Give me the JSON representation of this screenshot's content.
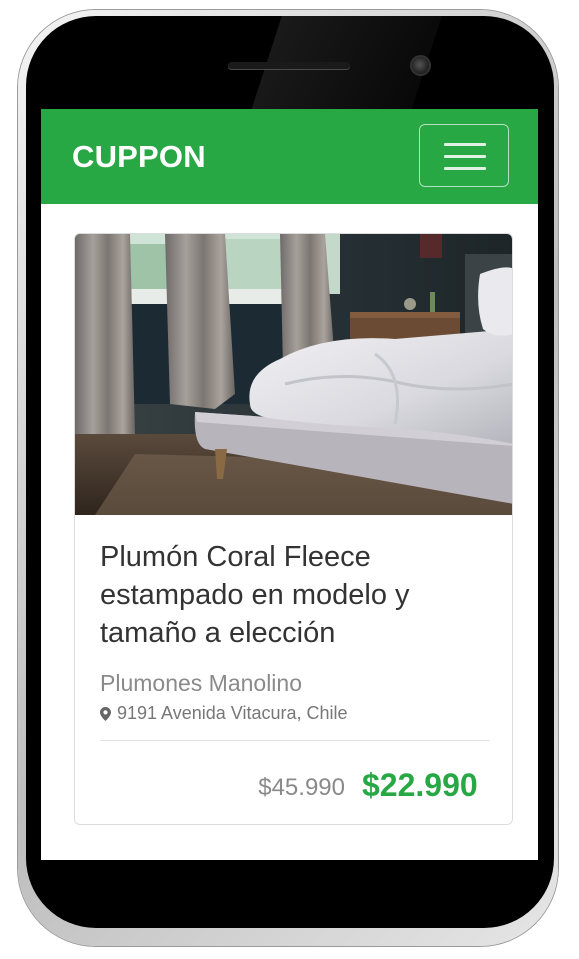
{
  "navbar": {
    "brand": "CUPPON",
    "brand_color": "#28a745"
  },
  "deal": {
    "image_description_icon": "bedroom-photo",
    "title": "Plumón Coral Fleece estampado en modelo y tamaño a elección",
    "merchant": "Plumones Manolino",
    "address": "9191 Avenida Vitacura, Chile",
    "old_price": "$45.990",
    "new_price": "$22.990"
  },
  "icons": {
    "menu": "hamburger-menu-icon",
    "location": "map-marker-icon"
  }
}
